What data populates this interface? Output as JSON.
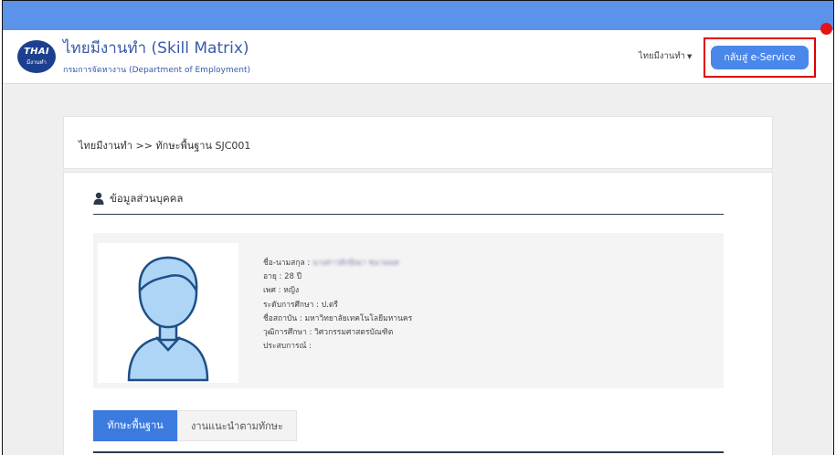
{
  "colors": {
    "accent": "#4a87ea",
    "brand": "#3a5aa8",
    "highlight": "#e00000"
  },
  "header": {
    "logo_line1": "THAI",
    "logo_line2": "มีงานทำ",
    "title": "ไทยมีงานทำ (Skill Matrix)",
    "subtitle": "กรมการจัดหางาน (Department of Employment)",
    "user_menu": "ไทยมีงานทำ",
    "eservice_button": "กลับสู่ e-Service"
  },
  "breadcrumb": "ไทยมีงานทำ >> ทักษะพื้นฐาน SJC001",
  "personal": {
    "section_title": "ข้อมูลส่วนบุคคล",
    "avatar_icon": "user-avatar-icon",
    "fields": [
      {
        "label": "ชื่อ-นามสกุล :",
        "value": "นางสาวทักษิณา ชนานนท"
      },
      {
        "label": "อายุ :",
        "value": "28 ปี"
      },
      {
        "label": "เพศ :",
        "value": "หญิง"
      },
      {
        "label": "ระดับการศึกษา :",
        "value": "ป.ตรี"
      },
      {
        "label": "ชื่อสถาบัน :",
        "value": "มหาวิทยาลัยเทคโนโลยีมหานคร"
      },
      {
        "label": "วุฒิการศึกษา :",
        "value": "วิศวกรรมศาสตรบัณฑิต"
      },
      {
        "label": "ประสบการณ์ :",
        "value": ""
      }
    ]
  },
  "tabs": [
    {
      "label": "ทักษะพื้นฐาน",
      "active": true
    },
    {
      "label": "งานแนะนำตามทักษะ",
      "active": false
    }
  ]
}
